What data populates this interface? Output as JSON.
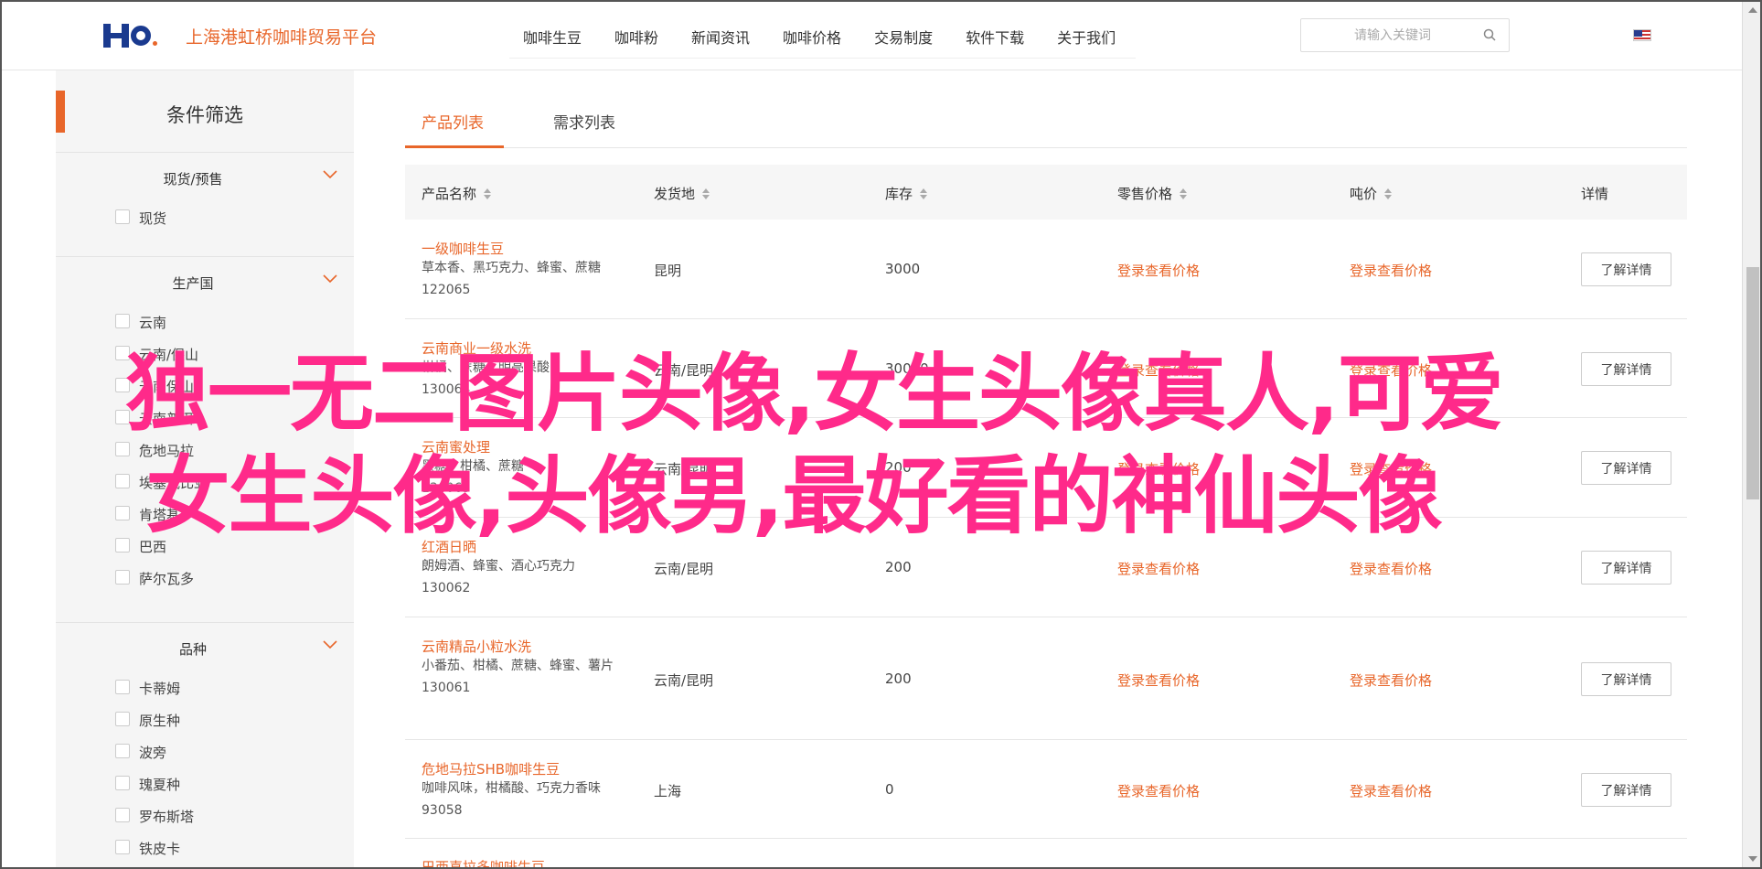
{
  "header": {
    "site_title": "上海港虹桥咖啡贸易平台",
    "nav": [
      "咖啡生豆",
      "咖啡粉",
      "新闻资讯",
      "咖啡价格",
      "交易制度",
      "软件下载",
      "关于我们"
    ],
    "search_placeholder": "请输入关键词"
  },
  "sidebar": {
    "title": "条件筛选",
    "groups": [
      {
        "title": "现货/预售",
        "options": [
          "现货"
        ]
      },
      {
        "title": "生产国",
        "options": [
          "云南",
          "云南/保山",
          "云南保山",
          "云南普洱",
          "危地马拉",
          "埃塞俄比亚",
          "肯塔基",
          "巴西",
          "萨尔瓦多"
        ]
      },
      {
        "title": "品种",
        "options": [
          "卡蒂姆",
          "原生种",
          "波旁",
          "瑰夏种",
          "罗布斯塔",
          "铁皮卡"
        ]
      }
    ]
  },
  "tabs": [
    "产品列表",
    "需求列表"
  ],
  "table": {
    "headers": [
      "产品名称",
      "发货地",
      "库存",
      "零售价格",
      "吨价",
      "详情"
    ],
    "price_label": "登录查看价格",
    "detail_label": "了解详情",
    "rows": [
      {
        "name": "一级咖啡生豆",
        "desc": "草本香、黑巧克力、蜂蜜、蔗糖",
        "code": "122065",
        "origin": "昆明",
        "stock": "3000"
      },
      {
        "name": "云南商业一级水洗",
        "desc": "柑橘、蔗糖、明亮果酸",
        "code": "130064",
        "origin": "云南/昆明",
        "stock": "30000"
      },
      {
        "name": "云南蜜处理",
        "desc": "黑糖、柑橘、蔗糖",
        "code": "130063",
        "origin": "云南/昆明",
        "stock": "200"
      },
      {
        "name": "红酒日晒",
        "desc": "朗姆酒、蜂蜜、酒心巧克力",
        "code": "130062",
        "origin": "云南/昆明",
        "stock": "200"
      },
      {
        "name": "云南精品小粒水洗",
        "desc": "小番茄、柑橘、蔗糖、蜂蜜、薯片",
        "code": "130061",
        "origin": "云南/昆明",
        "stock": "200"
      },
      {
        "name": "危地马拉SHB咖啡生豆",
        "desc": "咖啡风味，柑橘酸、巧克力香味",
        "code": "93058",
        "origin": "上海",
        "stock": "0"
      },
      {
        "name": "巴西喜拉多咖啡生豆",
        "desc": "",
        "code": "",
        "origin": "",
        "stock": ""
      }
    ]
  },
  "overlay": {
    "line1": "独一无二图片头像,女生头像真人,可爱",
    "line2": "女生头像,头像男,最好看的神仙头像"
  }
}
